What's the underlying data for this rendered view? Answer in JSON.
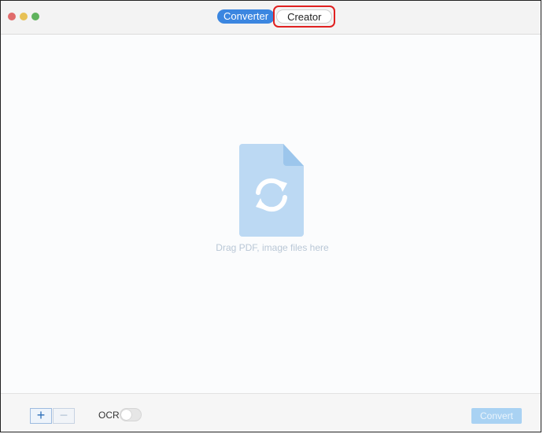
{
  "titlebar": {
    "tabs": {
      "converter": "Converter",
      "creator": "Creator"
    }
  },
  "dropzone": {
    "hint": "Drag PDF, image files here",
    "icon": "file-convert-icon"
  },
  "bottombar": {
    "add_label": "+",
    "remove_label": "−",
    "ocr_label": "OCR",
    "ocr_enabled": false,
    "convert_label": "Convert"
  },
  "colors": {
    "accent": "#3b86e0",
    "highlight": "#e02020",
    "convert_disabled": "#a9d2f3"
  }
}
